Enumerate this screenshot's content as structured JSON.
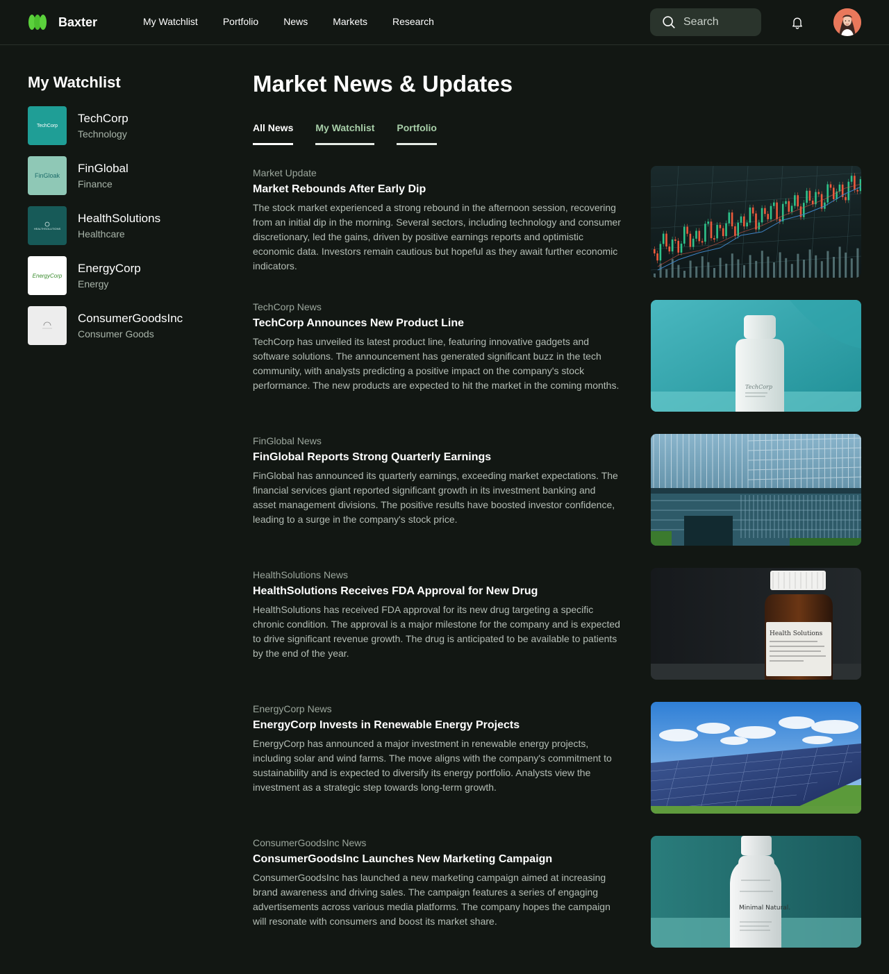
{
  "brand": {
    "name": "Baxter",
    "accent": "#5bd13c"
  },
  "nav": {
    "items": [
      "My Watchlist",
      "Portfolio",
      "News",
      "Markets",
      "Research"
    ]
  },
  "search": {
    "placeholder": "Search"
  },
  "icons": {
    "search": "search-icon",
    "notifications": "bell-icon",
    "avatar": "user-avatar"
  },
  "sidebar": {
    "title": "My Watchlist",
    "items": [
      {
        "name": "TechCorp",
        "sector": "Technology",
        "logo_text": "TechCorp",
        "logo_bg": "#1f9e96",
        "logo_fg": "#ffffff"
      },
      {
        "name": "FinGlobal",
        "sector": "Finance",
        "logo_text": "FinGloak",
        "logo_bg": "#8fc8b6",
        "logo_fg": "#1d6c6a"
      },
      {
        "name": "HealthSolutions",
        "sector": "Healthcare",
        "logo_text": "HEALTHSOLUTIONS",
        "logo_bg": "#175a58",
        "logo_fg": "#d9ece9"
      },
      {
        "name": "EnergyCorp",
        "sector": "Energy",
        "logo_text": "EnergyCorp",
        "logo_bg": "#ffffff",
        "logo_fg": "#3a8c2e"
      },
      {
        "name": "ConsumerGoodsInc",
        "sector": "Consumer Goods",
        "logo_text": "",
        "logo_bg": "#ededed",
        "logo_fg": "#8a8a8a"
      }
    ]
  },
  "main": {
    "title": "Market News & Updates",
    "tabs": [
      {
        "label": "All News"
      },
      {
        "label": "My Watchlist"
      },
      {
        "label": "Portfolio"
      }
    ],
    "articles": [
      {
        "category": "Market Update",
        "title": "Market Rebounds After Early Dip",
        "body": "The stock market experienced a strong rebound in the afternoon session, recovering from an initial dip in the morning. Several sectors, including technology and consumer discretionary, led the gains, driven by positive earnings reports and optimistic economic data. Investors remain cautious but hopeful as they await further economic indicators.",
        "image": "stock-chart-image"
      },
      {
        "category": "TechCorp News",
        "title": "TechCorp Announces New Product Line",
        "body": "TechCorp has unveiled its latest product line, featuring innovative gadgets and software solutions. The announcement has generated significant buzz in the tech community, with analysts predicting a positive impact on the company's stock performance. The new products are expected to hit the market in the coming months.",
        "image": "product-bottle-image",
        "image_label": "TechCorp"
      },
      {
        "category": "FinGlobal News",
        "title": "FinGlobal Reports Strong Quarterly Earnings",
        "body": "FinGlobal has announced its quarterly earnings, exceeding market expectations. The financial services giant reported significant growth in its investment banking and asset management divisions. The positive results have boosted investor confidence, leading to a surge in the company's stock price.",
        "image": "office-building-image"
      },
      {
        "category": "HealthSolutions News",
        "title": "HealthSolutions Receives FDA Approval for New Drug",
        "body": "HealthSolutions has received FDA approval for its new drug targeting a specific chronic condition. The approval is a major milestone for the company and is expected to drive significant revenue growth. The drug is anticipated to be available to patients by the end of the year.",
        "image": "medicine-bottle-image",
        "image_label": "Health Solutions"
      },
      {
        "category": "EnergyCorp News",
        "title": "EnergyCorp Invests in Renewable Energy Projects",
        "body": "EnergyCorp has announced a major investment in renewable energy projects, including solar and wind farms. The move aligns with the company's commitment to sustainability and is expected to diversify its energy portfolio. Analysts view the investment as a strategic step towards long-term growth.",
        "image": "solar-panel-image"
      },
      {
        "category": "ConsumerGoodsInc News",
        "title": "ConsumerGoodsInc Launches New Marketing Campaign",
        "body": "ConsumerGoodsInc has launched a new marketing campaign aimed at increasing brand awareness and driving sales. The campaign features a series of engaging advertisements across various media platforms. The company hopes the campaign will resonate with consumers and boost its market share.",
        "image": "consumer-bottle-image",
        "image_label": "Minimal Natural."
      }
    ]
  }
}
